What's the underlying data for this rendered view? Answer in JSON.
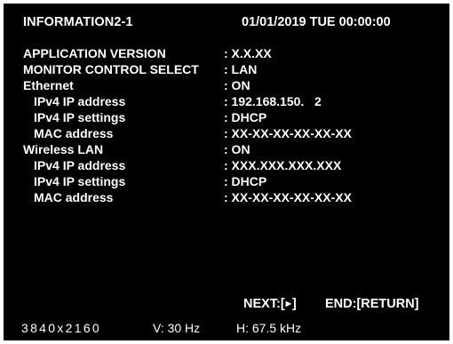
{
  "header": {
    "title": "INFORMATION2-1",
    "datetime": "01/01/2019 TUE 00:00:00"
  },
  "info": [
    {
      "label": "APPLICATION VERSION",
      "value": ": X.X.XX"
    },
    {
      "label": "MONITOR CONTROL SELECT",
      "value": ": LAN"
    },
    {
      "label": "Ethernet",
      "value": ": ON"
    },
    {
      "label": "IPv4 IP address",
      "value": ": 192.168.150.   2"
    },
    {
      "label": "IPv4 IP settings",
      "value": ": DHCP"
    },
    {
      "label": "MAC address",
      "value": ": XX-XX-XX-XX-XX-XX"
    },
    {
      "label": "Wireless LAN",
      "value": ": ON"
    },
    {
      "label": "IPv4 IP address",
      "value": ": XXX.XXX.XXX.XXX"
    },
    {
      "label": "IPv4 IP settings",
      "value": ": DHCP"
    },
    {
      "label": "MAC address",
      "value": ": XX-XX-XX-XX-XX-XX"
    }
  ],
  "footer": {
    "next_prefix": "NEXT:[",
    "next_icon": "play-right-icon",
    "next_suffix": "]",
    "end_label": "END:[RETURN]"
  },
  "signal": {
    "resolution": "3840x2160",
    "vertical_freq": "V: 30 Hz",
    "horizontal_freq": "H: 67.5 kHz"
  },
  "colors": {
    "background": "#000000",
    "text": "#ffffff",
    "border": "#ffffff"
  }
}
